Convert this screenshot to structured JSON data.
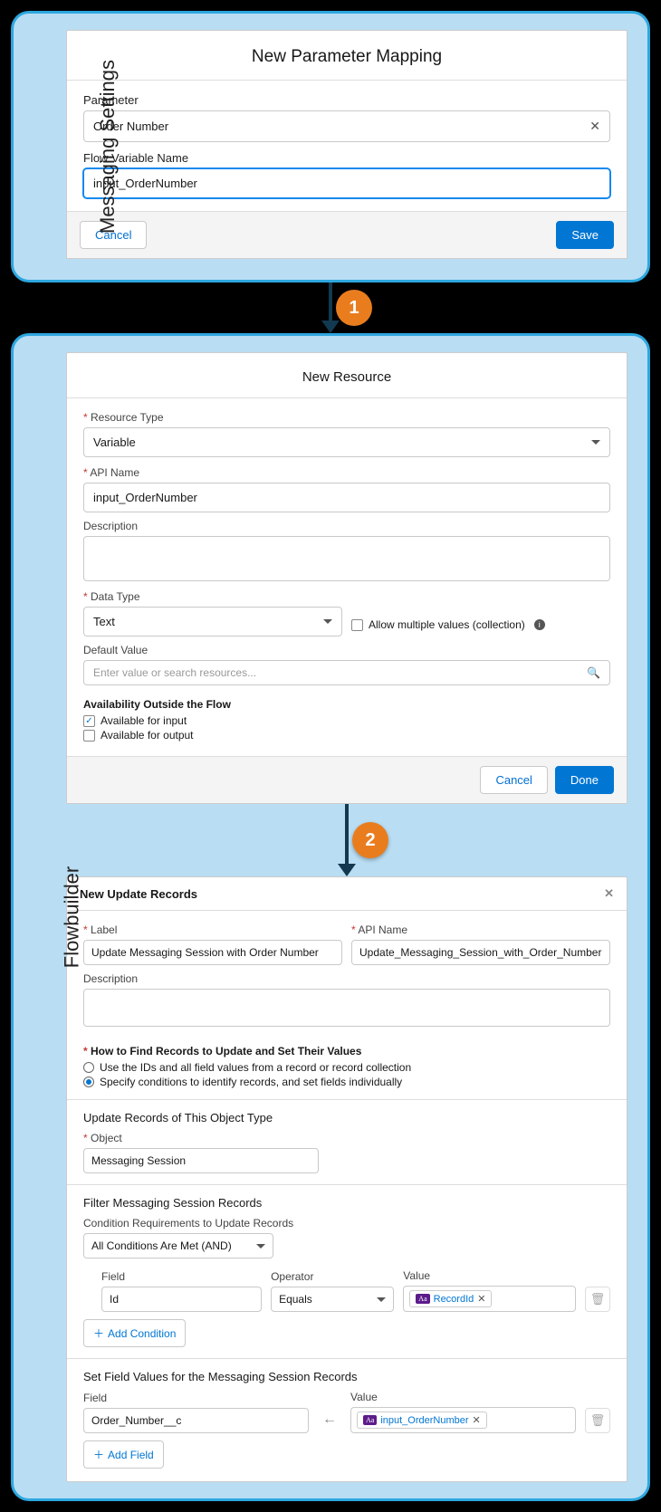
{
  "panel1": {
    "label": "Messaging Settings",
    "card_title": "New Parameter Mapping",
    "param_label": "Parameter",
    "param_value": "Order Number",
    "flowvar_label": "Flow Variable Name",
    "flowvar_value": "input_OrderNumber",
    "cancel": "Cancel",
    "save": "Save"
  },
  "step1": "1",
  "panel2": {
    "label": "Flowbuilder",
    "new_resource": {
      "title": "New Resource",
      "rtype_label": "Resource Type",
      "rtype_value": "Variable",
      "api_label": "API Name",
      "api_value": "input_OrderNumber",
      "desc_label": "Description",
      "dtype_label": "Data Type",
      "dtype_value": "Text",
      "allow_multi": "Allow multiple values (collection)",
      "default_label": "Default Value",
      "default_placeholder": "Enter value or search resources...",
      "avail_heading": "Availability Outside the Flow",
      "avail_input": "Available for input",
      "avail_output": "Available for output",
      "cancel": "Cancel",
      "done": "Done"
    },
    "step2": "2",
    "update_records": {
      "title": "New Update Records",
      "label_label": "Label",
      "label_value": "Update Messaging Session with Order Number",
      "api_label": "API Name",
      "api_value": "Update_Messaging_Session_with_Order_Number",
      "desc_label": "Description",
      "howto_heading": "How to Find Records to Update and Set Their Values",
      "radio1": "Use the IDs and all field values from a record or record collection",
      "radio2": "Specify conditions to identify records, and set fields individually",
      "update_obj_heading": "Update Records of This Object Type",
      "object_label": "Object",
      "object_value": "Messaging Session",
      "filter_heading": "Filter Messaging Session Records",
      "cond_req_label": "Condition Requirements to Update Records",
      "cond_req_value": "All Conditions Are Met (AND)",
      "field_label": "Field",
      "field_value": "Id",
      "operator_label": "Operator",
      "operator_value": "Equals",
      "value_label": "Value",
      "value_pill": "RecordId",
      "add_condition": "Add Condition",
      "set_values_heading": "Set Field Values for the Messaging Session Records",
      "sv_field_label": "Field",
      "sv_field_value": "Order_Number__c",
      "sv_value_label": "Value",
      "sv_value_pill": "input_OrderNumber",
      "add_field": "Add Field"
    }
  }
}
